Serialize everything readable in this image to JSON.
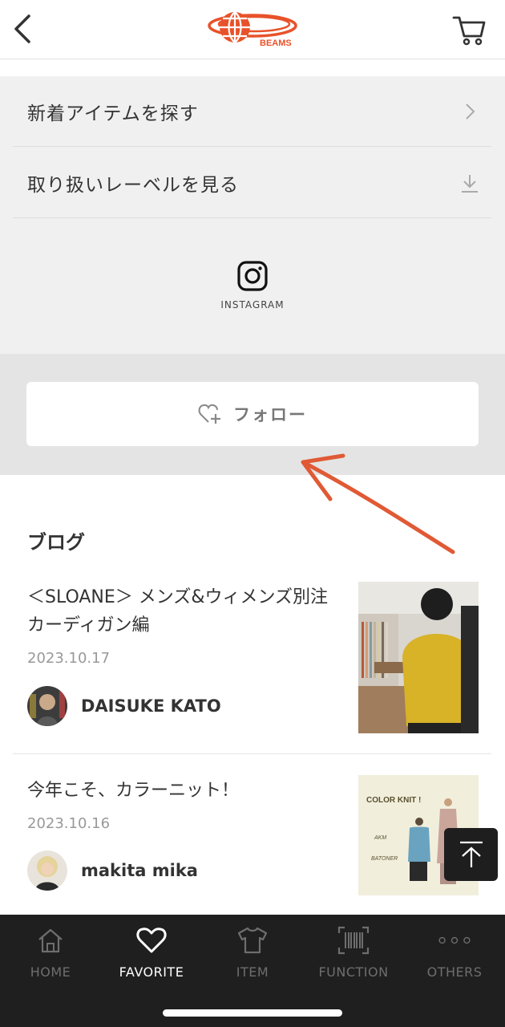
{
  "header": {
    "logo_text": "BEAMS"
  },
  "links": {
    "items": [
      {
        "label": "新着アイテムを探す",
        "icon": "chevron-right-icon"
      },
      {
        "label": "取り扱いレーベルを見る",
        "icon": "download-arrow-icon"
      }
    ],
    "instagram_label": "INSTAGRAM"
  },
  "follow": {
    "label": "フォロー"
  },
  "blog": {
    "heading": "ブログ",
    "posts": [
      {
        "title": "＜SLOANE＞ メンズ&ウィメンズ別注カーディガン編",
        "date": "2023.10.17",
        "author": "DAISUKE KATO"
      },
      {
        "title": "今年こそ、カラーニット！",
        "date": "2023.10.16",
        "author": "makita mika",
        "thumb_text": {
          "title": "COLOR KNIT !",
          "label1": "AKM",
          "label2": "BATONER"
        }
      }
    ]
  },
  "tabs": [
    {
      "label": "HOME",
      "icon": "home-icon",
      "active": false
    },
    {
      "label": "FAVORITE",
      "icon": "heart-icon",
      "active": true
    },
    {
      "label": "ITEM",
      "icon": "tshirt-icon",
      "active": false
    },
    {
      "label": "FUNCTION",
      "icon": "barcode-icon",
      "active": false
    },
    {
      "label": "OTHERS",
      "icon": "more-dots-icon",
      "active": false
    }
  ],
  "colors": {
    "brand_orange": "#e8522a",
    "annotation_arrow": "#e05a35",
    "tabbar_bg": "#1f1f1f"
  }
}
